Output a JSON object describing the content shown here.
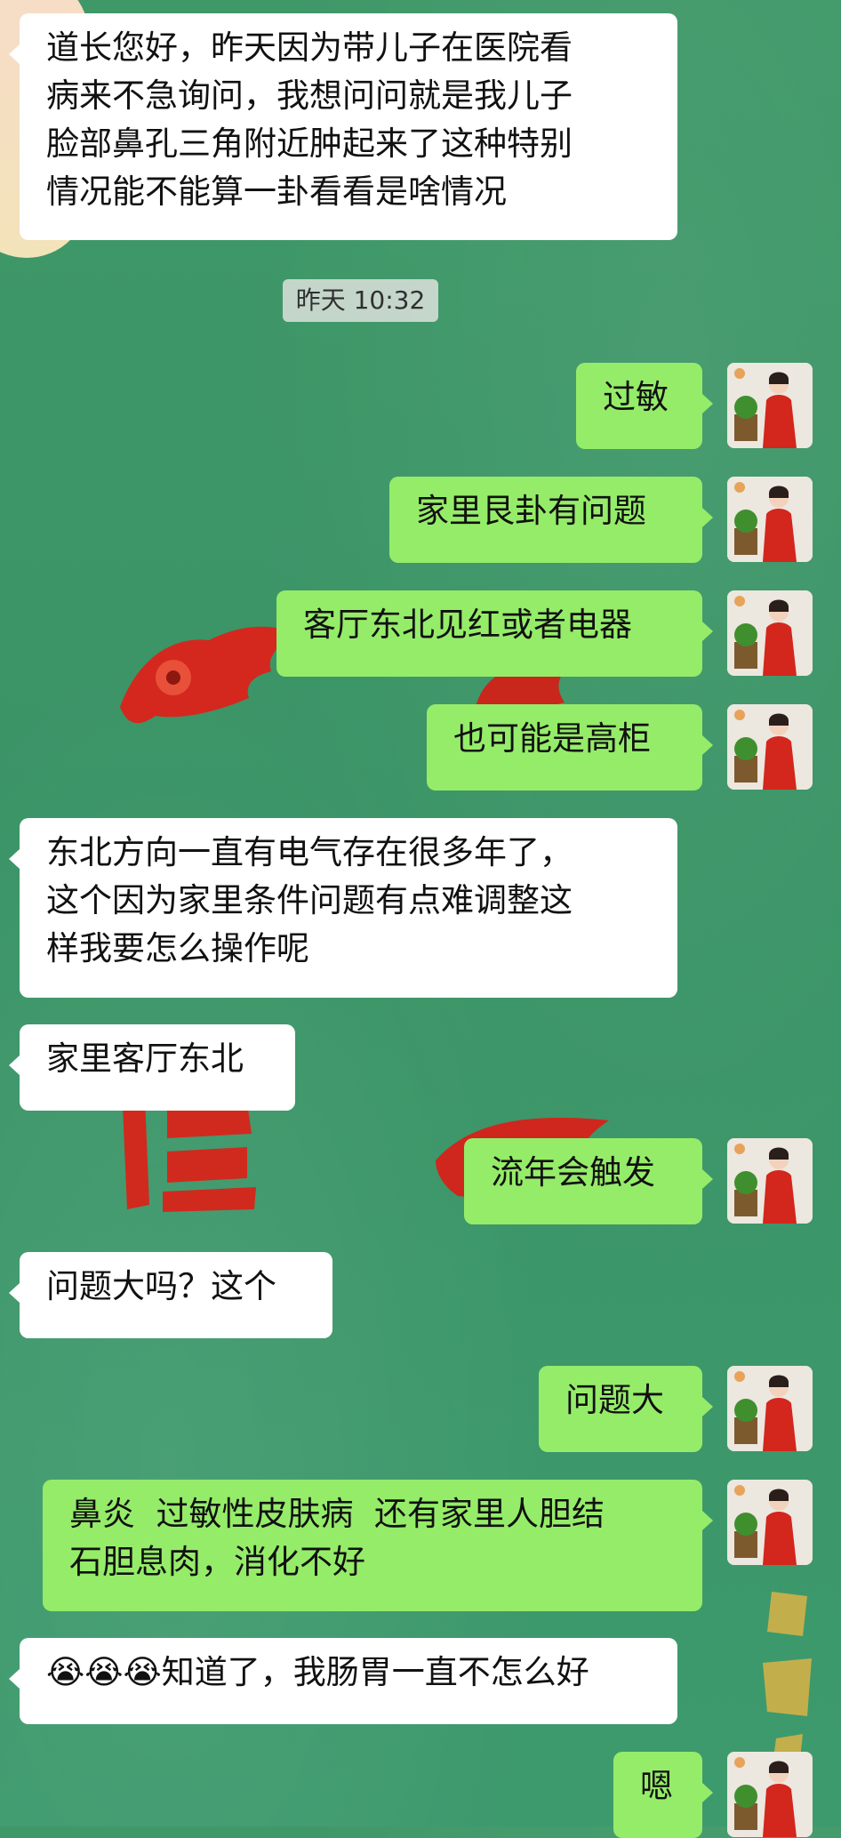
{
  "chat": {
    "timestamp": "昨天 10:32",
    "messages": [
      {
        "side": "left",
        "text": "道长您好，昨天因为带儿子在医院看\n病来不急询问，我想问问就是我儿子\n脸部鼻孔三角附近肿起来了这种特别\n情况能不能算一卦看看是啥情况"
      },
      {
        "side": "right",
        "text": "过敏"
      },
      {
        "side": "right",
        "text": "家里艮卦有问题"
      },
      {
        "side": "right",
        "text": "客厅东北见红或者电器"
      },
      {
        "side": "right",
        "text": "也可能是高柜"
      },
      {
        "side": "left",
        "text": "东北方向一直有电气存在很多年了，\n这个因为家里条件问题有点难调整这\n样我要怎么操作呢"
      },
      {
        "side": "left",
        "text": "家里客厅东北"
      },
      {
        "side": "right",
        "text": "流年会触发"
      },
      {
        "side": "left",
        "text": "问题大吗？这个"
      },
      {
        "side": "right",
        "text": "问题大"
      },
      {
        "side": "right",
        "text": "鼻炎  过敏性皮肤病  还有家里人胆结\n石胆息肉，消化不好"
      },
      {
        "side": "left",
        "text": "😭😭😭知道了，我肠胃一直不怎么好"
      },
      {
        "side": "right",
        "text": "嗯"
      }
    ]
  },
  "colors": {
    "background": "#3c9868",
    "left_bubble": "#ffffff",
    "right_bubble": "#95ec69",
    "timestamp_bg": "#d9dfd9"
  },
  "icons": {
    "avatar": "avatar-red-robed-person-with-bonsai-icon"
  }
}
